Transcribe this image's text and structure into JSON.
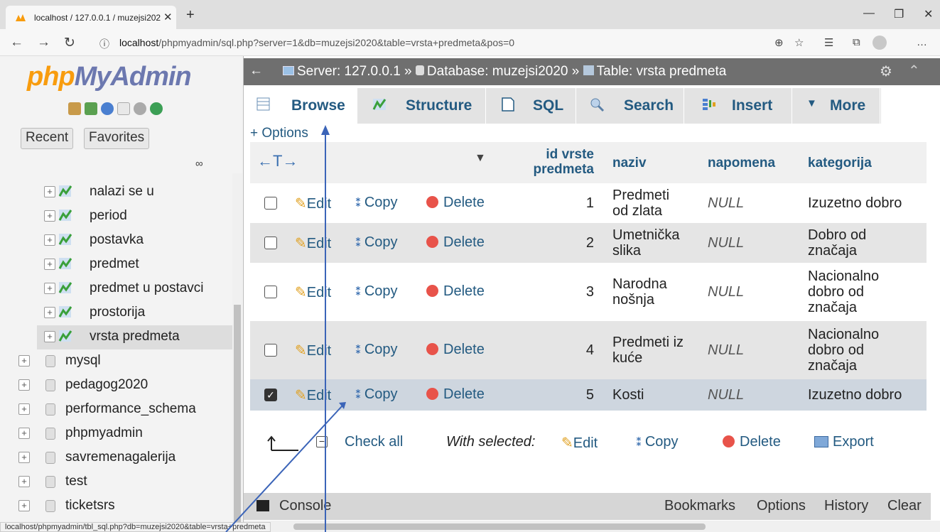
{
  "browser": {
    "tab_title": "localhost / 127.0.0.1 / muzejsi202",
    "url_host": "localhost",
    "url_path": "/phpmyadmin/sql.php?server=1&db=muzejsi2020&table=vrsta+predmeta&pos=0",
    "status_url": "localhost/phpmyadmin/tbl_sql.php?db=muzejsi2020&table=vrsta+predmeta"
  },
  "logo": {
    "php": "php",
    "myadmin": "MyAdmin"
  },
  "sidebar": {
    "recent": "Recent",
    "favorites": "Favorites",
    "tables": [
      {
        "label": "nalazi se u"
      },
      {
        "label": "period"
      },
      {
        "label": "postavka"
      },
      {
        "label": "predmet"
      },
      {
        "label": "predmet u postavci"
      },
      {
        "label": "prostorija"
      },
      {
        "label": "vrsta predmeta"
      }
    ],
    "databases": [
      {
        "label": "mysql"
      },
      {
        "label": "pedagog2020"
      },
      {
        "label": "performance_schema"
      },
      {
        "label": "phpmyadmin"
      },
      {
        "label": "savremenagalerija"
      },
      {
        "label": "test"
      },
      {
        "label": "ticketsrs"
      }
    ]
  },
  "breadcrumb": {
    "server": "Server: 127.0.0.1",
    "database": "Database: muzejsi2020",
    "table": "Table: vrsta predmeta"
  },
  "tabs": [
    "Browse",
    "Structure",
    "SQL",
    "Search",
    "Insert",
    "More"
  ],
  "options_link": "+ Options",
  "columns": {
    "id": [
      "id vrste",
      "predmeta"
    ],
    "naziv": "naziv",
    "napomena": "napomena",
    "kategorija": "kategorija"
  },
  "row_actions": {
    "edit": "Edit",
    "copy": "Copy",
    "delete": "Delete"
  },
  "rows": [
    {
      "id": "1",
      "naziv": [
        "Predmeti",
        "od zlata"
      ],
      "napomena": "NULL",
      "kategorija": [
        "Izuzetno dobro"
      ],
      "checked": false
    },
    {
      "id": "2",
      "naziv": [
        "Umetnička",
        "slika"
      ],
      "napomena": "NULL",
      "kategorija": [
        "Dobro od",
        "značaja"
      ],
      "checked": false
    },
    {
      "id": "3",
      "naziv": [
        "Narodna",
        "nošnja"
      ],
      "napomena": "NULL",
      "kategorija": [
        "Nacionalno",
        "dobro od",
        "značaja"
      ],
      "checked": false
    },
    {
      "id": "4",
      "naziv": [
        "Predmeti iz",
        "kuće"
      ],
      "napomena": "NULL",
      "kategorija": [
        "Nacionalno",
        "dobro od",
        "značaja"
      ],
      "checked": false
    },
    {
      "id": "5",
      "naziv": [
        "Kosti"
      ],
      "napomena": "NULL",
      "kategorija": [
        "Izuzetno dobro"
      ],
      "checked": true
    }
  ],
  "footer": {
    "check_all": "Check all",
    "with_selected": "With selected:",
    "edit": "Edit",
    "copy": "Copy",
    "delete": "Delete",
    "export": "Export"
  },
  "console": {
    "label": "Console",
    "bookmarks": "Bookmarks",
    "options": "Options",
    "history": "History",
    "clear": "Clear"
  },
  "colors": {
    "link": "#235a81",
    "logo_blue": "#6c78af",
    "logo_orange": "#f89c0e",
    "marked_row": "#ced6df",
    "annotation": "#3b64b8"
  }
}
